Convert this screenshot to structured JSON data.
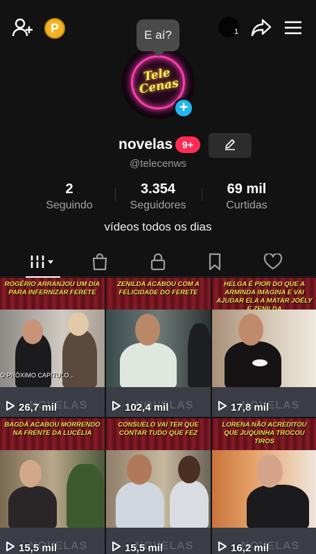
{
  "topbar": {
    "icons": [
      "add-friend-icon",
      "coin-icon",
      "avatar-icon",
      "share-icon",
      "menu-icon"
    ],
    "coin_letter": "P",
    "tiny_count": "1"
  },
  "profile": {
    "bubble_text": "E aí?",
    "avatar_text_line1": "Tele",
    "avatar_text_line2": "Cenas",
    "add_symbol": "+",
    "display_name": "novelas",
    "notification_badge": "9+",
    "handle": "@telecenws",
    "bio": "vídeos todos os dias"
  },
  "stats": [
    {
      "value": "2",
      "label": "Seguindo"
    },
    {
      "value": "3.354",
      "label": "Seguidores"
    },
    {
      "value": "69 mil",
      "label": "Curtidas"
    }
  ],
  "tabs": [
    {
      "icon": "grid-icon",
      "active": true
    },
    {
      "icon": "shopping-bag-icon",
      "active": false
    },
    {
      "icon": "lock-icon",
      "active": false
    },
    {
      "icon": "bookmark-icon",
      "active": false
    },
    {
      "icon": "heart-icon",
      "active": false
    }
  ],
  "videos": [
    {
      "caption": "Rogério arranjou um dia para infernizar Ferete",
      "subtitle": "O PRÓXIMO CAPÍTULO...",
      "views": "26,7 mil"
    },
    {
      "caption": "Zenilda acabou com a felicidade do Ferete",
      "subtitle": "",
      "views": "102,4 mil"
    },
    {
      "caption": "Helga é pior do que a Arminda imagina e vai ajudar ela a matar Joély e Zenilda",
      "subtitle": "",
      "views": "17,8 mil"
    },
    {
      "caption": "Bagdá acabou morrendo na frente da Lucélia",
      "subtitle": "",
      "views": "15,5 mil"
    },
    {
      "caption": "Consuelo vai ter que contar tudo que fez",
      "subtitle": "",
      "views": "15,5 mil"
    },
    {
      "caption": "Lorena não acreditou que Juquinha trocou tiros",
      "subtitle": "",
      "views": "16,2 mil"
    }
  ],
  "watermark": "NOVELAS",
  "colors": {
    "accent_pink": "#fe2c55",
    "add_blue": "#20b6f0",
    "caption_yellow": "#ffe24a",
    "coin_gold": "#f4b323"
  }
}
